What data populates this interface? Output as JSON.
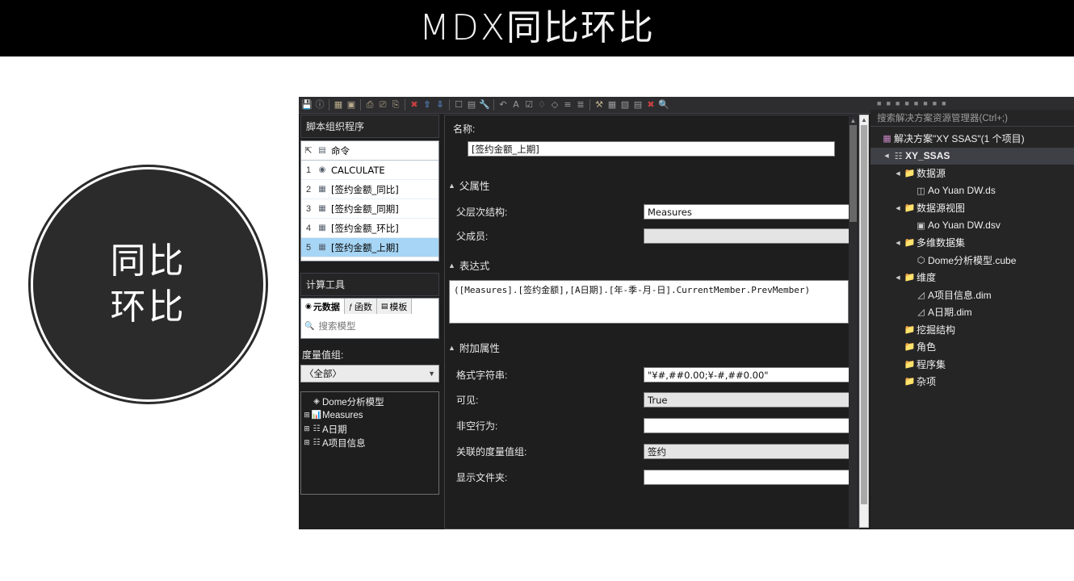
{
  "slide": {
    "title": "MDX同比环比",
    "badge_lines": [
      "同比",
      "环比"
    ]
  },
  "window": {
    "toolbar": {
      "icons": [
        "save-icon",
        "help-icon",
        "sep",
        "new-calculated-member-icon",
        "new-named-set-icon",
        "sep",
        "copy-icon",
        "paste-icon",
        "duplicate-icon",
        "sep",
        "delete-icon",
        "move-up-icon",
        "move-down-icon",
        "sep",
        "form-view-icon",
        "script-view-icon",
        "tools-icon",
        "sep",
        "undo-icon",
        "font-icon",
        "checkmark-icon",
        "comment-icon",
        "uncomment-icon",
        "indent-icon",
        "outdent-icon",
        "sep",
        "process-icon",
        "grid-icon",
        "table-icon",
        "filter-icon",
        "clear-icon",
        "zoom-icon"
      ]
    },
    "script_organizer": {
      "header": "脚本组织程序",
      "column_header": "命令",
      "rows": [
        {
          "num": "1",
          "label": "CALCULATE",
          "icon": "calculate-icon",
          "selected": false
        },
        {
          "num": "2",
          "label": "[签约金额_同比]",
          "icon": "calculated-member-icon",
          "selected": false
        },
        {
          "num": "3",
          "label": "[签约金额_同期]",
          "icon": "calculated-member-icon",
          "selected": false
        },
        {
          "num": "4",
          "label": "[签约金额_环比]",
          "icon": "calculated-member-icon",
          "selected": false
        },
        {
          "num": "5",
          "label": "[签约金额_上期]",
          "icon": "calculated-member-icon",
          "selected": true
        }
      ]
    },
    "calculation_tools": {
      "header": "计算工具",
      "tabs": [
        {
          "label": "元数据",
          "icon": "metadata-icon",
          "active": true
        },
        {
          "label": "函数",
          "icon": "function-icon",
          "active": false
        },
        {
          "label": "模板",
          "icon": "template-icon",
          "active": false
        }
      ],
      "search_placeholder": "搜索模型",
      "measure_group_label": "度量值组:",
      "measure_group_value": "〈全部〉",
      "tree": [
        {
          "label": "Dome分析模型",
          "icon": "cube-icon",
          "expander": ""
        },
        {
          "label": "Measures",
          "icon": "measures-icon",
          "expander": "+"
        },
        {
          "label": "A日期",
          "icon": "dimension-icon",
          "expander": "+"
        },
        {
          "label": "A项目信息",
          "icon": "dimension-icon",
          "expander": "+"
        }
      ]
    },
    "form": {
      "name_label": "名称:",
      "name_value": "[签约金额_上期]",
      "parent_properties_title": "父属性",
      "parent_hierarchy_label": "父层次结构:",
      "parent_hierarchy_value": "Measures",
      "parent_member_label": "父成员:",
      "parent_member_value": "",
      "expression_title": "表达式",
      "expression_value": "([Measures].[签约金额],[A日期].[年-季-月-日].CurrentMember.PrevMember)",
      "additional_properties_title": "附加属性",
      "format_string_label": "格式字符串:",
      "format_string_value": "\"¥#,##0.00;¥-#,##0.00\"",
      "visible_label": "可见:",
      "visible_value": "True",
      "non_empty_behavior_label": "非空行为:",
      "non_empty_behavior_value": "",
      "associated_measure_group_label": "关联的度量值组:",
      "associated_measure_group_value": "签约",
      "display_folder_label": "显示文件夹:",
      "display_folder_value": ""
    },
    "solution_explorer": {
      "search_placeholder": "搜索解决方案资源管理器(Ctrl+;)",
      "tree": [
        {
          "label": "解决方案\"XY SSAS\"(1 个项目)",
          "icon": "solution-icon",
          "expander": "",
          "indent": 0,
          "selected": false
        },
        {
          "label": "XY_SSAS",
          "icon": "project-icon",
          "expander": "▲",
          "indent": 1,
          "selected": true
        },
        {
          "label": "数据源",
          "icon": "folder-icon",
          "expander": "▲",
          "indent": 2,
          "selected": false
        },
        {
          "label": "Ao Yuan DW.ds",
          "icon": "datasource-icon",
          "expander": "",
          "indent": 3,
          "selected": false
        },
        {
          "label": "数据源视图",
          "icon": "folder-icon",
          "expander": "▲",
          "indent": 2,
          "selected": false
        },
        {
          "label": "Ao Yuan DW.dsv",
          "icon": "dsv-icon",
          "expander": "",
          "indent": 3,
          "selected": false
        },
        {
          "label": "多维数据集",
          "icon": "folder-icon",
          "expander": "▲",
          "indent": 2,
          "selected": false
        },
        {
          "label": "Dome分析模型.cube",
          "icon": "cube-icon",
          "expander": "",
          "indent": 3,
          "selected": false
        },
        {
          "label": "维度",
          "icon": "folder-icon",
          "expander": "▲",
          "indent": 2,
          "selected": false
        },
        {
          "label": "A项目信息.dim",
          "icon": "dimension-icon",
          "expander": "",
          "indent": 3,
          "selected": false
        },
        {
          "label": "A日期.dim",
          "icon": "dimension-icon",
          "expander": "",
          "indent": 3,
          "selected": false
        },
        {
          "label": "挖掘结构",
          "icon": "folder-icon",
          "expander": "",
          "indent": 2,
          "selected": false
        },
        {
          "label": "角色",
          "icon": "folder-icon",
          "expander": "",
          "indent": 2,
          "selected": false
        },
        {
          "label": "程序集",
          "icon": "folder-icon",
          "expander": "",
          "indent": 2,
          "selected": false
        },
        {
          "label": "杂项",
          "icon": "folder-icon",
          "expander": "",
          "indent": 2,
          "selected": false
        }
      ]
    }
  },
  "colors": {
    "banner_bg": "#000000",
    "badge_bg": "#2b2b2b",
    "window_bg": "#1e1e1e",
    "selection_blue": "#a6d5f5",
    "se_selection": "#3f3f46",
    "accent_red": "#c94040",
    "accent_blue": "#5b8dd0"
  }
}
